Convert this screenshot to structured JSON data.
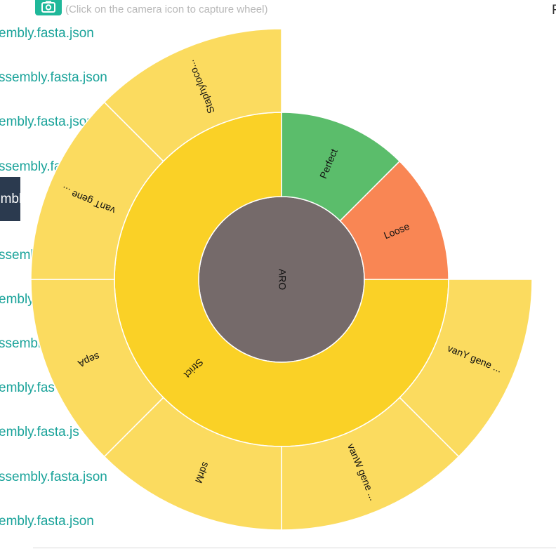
{
  "toolbar": {
    "camera_icon": "camera-icon",
    "hint": "(Click on the camera icon to capture wheel)",
    "corner_text": "F"
  },
  "file_list": {
    "items": [
      "embly.fasta.json",
      "ssembly.fasta.json",
      "embly.fasta.json",
      "ssembly.fasta.json",
      "embly",
      "ssemb",
      "embly",
      "ssembl",
      "embly.fas",
      "embly.fasta.js",
      "ssembly.fasta.json",
      "embly.fasta.json"
    ]
  },
  "chart_data": {
    "type": "sunburst",
    "root": {
      "label": "ARO",
      "color": "#756a6a"
    },
    "levels": [
      {
        "label": "Perfect",
        "value": 1,
        "color": "#5bbd6b",
        "children": []
      },
      {
        "label": "Loose",
        "value": 1,
        "color": "#f98654",
        "children": []
      },
      {
        "label": "Strict",
        "value": 6,
        "color": "#fad126",
        "children": [
          {
            "label": "vanY gene ...",
            "value": 1,
            "color": "#fbdb5f"
          },
          {
            "label": "vanW gene ...",
            "value": 1,
            "color": "#fbdb5f"
          },
          {
            "label": "sdrM",
            "value": 1,
            "color": "#fbdb5f"
          },
          {
            "label": "sepA",
            "value": 1,
            "color": "#fbdb5f"
          },
          {
            "label": "vanT gene ...",
            "value": 1,
            "color": "#fbdb5f"
          },
          {
            "label": "Staphyloco...",
            "value": 1,
            "color": "#fbdb5f"
          }
        ]
      }
    ]
  }
}
